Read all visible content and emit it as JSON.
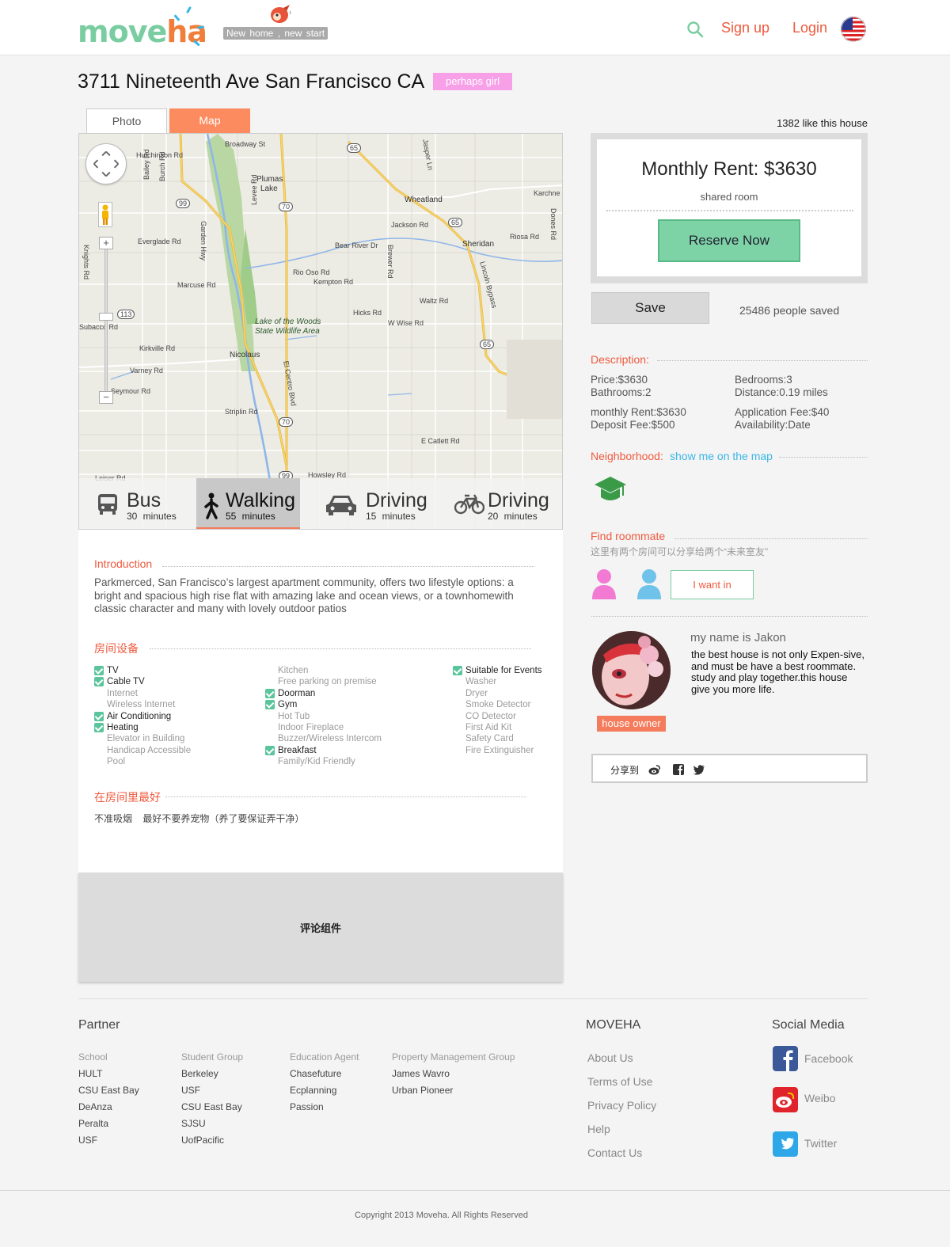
{
  "header": {
    "logo_part1": "move",
    "logo_part2": "ha",
    "tagline": "New home , new start",
    "signup": "Sign up",
    "login": "Login",
    "icons": {
      "search": "search-icon",
      "flag": "us-flag-icon",
      "mascot": "bird-mascot-icon"
    }
  },
  "listing": {
    "title": "3711 Nineteenth Ave San Francisco CA",
    "tag": "perhaps girl",
    "tabs": [
      "Photo",
      "Map"
    ],
    "active_tab": "Map"
  },
  "map": {
    "places": {
      "broadway": "Broadway St",
      "hutchinson": "Hutchinson Rd",
      "bailey": "Bailey Rd",
      "burch": "Burch Rd",
      "plumas": "Plumas",
      "lake": "Lake",
      "everglade": "Everglade Rd",
      "garden": "Garden Hwy",
      "levee": "Levee Rd",
      "marcuse": "Marcuse Rd",
      "knights": "Knights Rd",
      "subacco": "Subacco Rd",
      "kirkville": "Kirkville Rd",
      "varney": "Varney Rd",
      "seymour": "Seymour Rd",
      "leiser": "Leiser Rd",
      "nicolaus": "Nicolaus",
      "striplin": "Striplin Rd",
      "elcentro": "El Centro Blvd",
      "lakewoods1": "Lake of the Woods",
      "lakewoods2": "State Wildlife Area",
      "jackson": "Jackson Rd",
      "bearriver": "Bear River Dr",
      "riooso": "Rio Oso Rd",
      "kempton": "Kempton Rd",
      "hicks": "Hicks Rd",
      "wwise": "W Wise Rd",
      "brewer": "Brewer Rd",
      "waltz": "Waltz Rd",
      "wheatland": "Wheatland",
      "sheridan": "Sheridan",
      "riosa": "Riosa Rd",
      "karch": "Karchne",
      "dones": "Dones Rd",
      "jasper": "Jasper Ln",
      "lincoln": "Lincoln Bypass",
      "catlett": "E Catlett Rd",
      "howsley": "Howsley Rd",
      "r65a": "65",
      "r65b": "65",
      "r65c": "65",
      "r99a": "99",
      "r99b": "99",
      "r70a": "70",
      "r70b": "70",
      "r113": "113"
    },
    "zoom_in": "+",
    "zoom_out": "−",
    "modes": [
      {
        "name": "Bus",
        "minutes": "30 minutes",
        "icon": "bus-icon"
      },
      {
        "name": "Walking",
        "minutes": "55 minutes",
        "icon": "walking-icon"
      },
      {
        "name": "Driving",
        "minutes": "15 minutes",
        "icon": "car-icon"
      },
      {
        "name": "Driving",
        "minutes": "20 minutes",
        "icon": "bicycle-icon"
      }
    ],
    "active_mode": "Walking"
  },
  "intro": {
    "title": "Introduction",
    "text": "Parkmerced, San Francisco’s largest apartment community, offers two lifestyle options: a bright and spacious high rise flat with amazing lake and ocean views, or a townhomewith classic character and many with lovely outdoor patios"
  },
  "amenities": {
    "title": "房间设备",
    "col1": [
      {
        "label": "TV",
        "on": true
      },
      {
        "label": "Cable TV",
        "on": true
      },
      {
        "label": "Internet",
        "on": false
      },
      {
        "label": "Wireless Internet",
        "on": false
      },
      {
        "label": "Air Conditioning",
        "on": true
      },
      {
        "label": "Heating",
        "on": true
      },
      {
        "label": "Elevator in Building",
        "on": false
      },
      {
        "label": "Handicap Accessible",
        "on": false
      },
      {
        "label": "Pool",
        "on": false
      }
    ],
    "col2": [
      {
        "label": "Kitchen",
        "on": false
      },
      {
        "label": "Free parking on premise",
        "on": false
      },
      {
        "label": "Doorman",
        "on": true
      },
      {
        "label": "Gym",
        "on": true
      },
      {
        "label": "Hot Tub",
        "on": false
      },
      {
        "label": "Indoor Fireplace",
        "on": false
      },
      {
        "label": "Buzzer/Wireless Intercom",
        "on": false
      },
      {
        "label": "Breakfast",
        "on": true
      },
      {
        "label": "Family/Kid Friendly",
        "on": false
      }
    ],
    "col3": [
      {
        "label": "Suitable for Events",
        "on": true
      },
      {
        "label": "Washer",
        "on": false
      },
      {
        "label": "Dryer",
        "on": false
      },
      {
        "label": "Smoke Detector",
        "on": false
      },
      {
        "label": "CO Detector",
        "on": false
      },
      {
        "label": "First Aid Kit",
        "on": false
      },
      {
        "label": "Safety Card",
        "on": false
      },
      {
        "label": "Fire Extinguisher",
        "on": false
      }
    ]
  },
  "rules": {
    "title": "在房间里最好",
    "text": "不准吸烟    最好不要养宠物（养了要保证弄干净）"
  },
  "comments": {
    "placeholder": "评论组件"
  },
  "pricing": {
    "likes": "1382 like this house",
    "monthly_rent": "Monthly Rent: $3630",
    "room_type": "shared room",
    "reserve": "Reserve Now",
    "save": "Save",
    "saved_count": "25486 people saved"
  },
  "description": {
    "title": "Description:",
    "price": "Price:$3630",
    "bedrooms": "Bedrooms:3",
    "bathrooms": "Bathrooms:2",
    "distance": "Distance:0.19 miles",
    "monthly_rent": "monthly Rent:$3630",
    "application_fee": "Application Fee:$40",
    "deposit_fee": "Deposit Fee:$500",
    "availability": "Availability:Date"
  },
  "neighborhood": {
    "title": "Neighborhood:",
    "link": "show me on the map",
    "icon": "graduation-cap-icon"
  },
  "roommate": {
    "title": "Find roommate",
    "subtitle": "这里有两个房间可以分享给两个“未来室友”",
    "want_in": "I want in",
    "colors": {
      "female": "#f27ad3",
      "male": "#6fc3ea"
    }
  },
  "owner": {
    "name": "my name is Jakon",
    "quote": "the best house is not only Expen-sive, and must be have a best roommate. study and play together.this house give you more life.",
    "badge": "house owner"
  },
  "share": {
    "label": "分享到",
    "icons": [
      "weibo-icon",
      "facebook-icon",
      "twitter-icon"
    ]
  },
  "footer": {
    "partner_title": "Partner",
    "columns": [
      {
        "head": "School",
        "items": [
          "HULT",
          "CSU East Bay",
          "DeAnza",
          "Peralta",
          "USF"
        ]
      },
      {
        "head": "Student Group",
        "items": [
          "Berkeley",
          "USF",
          "CSU East Bay",
          "SJSU",
          "UofPacific"
        ]
      },
      {
        "head": "Education Agent",
        "items": [
          "Chasefuture",
          "Ecplanning",
          "Passion"
        ]
      },
      {
        "head": "Property Management Group",
        "items": [
          "James Wavro",
          "Urban Pioneer"
        ]
      }
    ],
    "moveha_title": "MOVEHA",
    "moveha_links": [
      "About Us",
      "Terms of Use",
      "Privacy Policy",
      "Help",
      "Contact Us"
    ],
    "social_title": "Social Media",
    "social": [
      {
        "name": "Facebook",
        "icon": "facebook-icon",
        "color": "#3b5998"
      },
      {
        "name": "Weibo",
        "icon": "weibo-icon",
        "color": "#e0242b"
      },
      {
        "name": "Twitter",
        "icon": "twitter-icon",
        "color": "#2ea7e8"
      }
    ],
    "copyright": "Copyright 2013 Moveha.  All Rights Reserved"
  },
  "colors": {
    "accent": "#ef5a3e",
    "brand_green": "#79cda0",
    "brand_orange": "#f07e3a",
    "brand_blue": "#3bb5e6"
  }
}
